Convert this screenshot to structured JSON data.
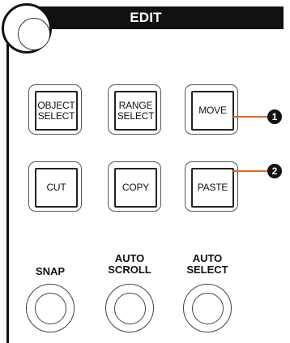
{
  "panel": {
    "title": "EDIT"
  },
  "buttons": {
    "object_select": "OBJECT\nSELECT",
    "range_select": "RANGE\nSELECT",
    "move": "MOVE",
    "cut": "CUT",
    "copy": "COPY",
    "paste": "PASTE"
  },
  "round_buttons": {
    "snap": "SNAP",
    "auto_scroll": "AUTO\nSCROLL",
    "auto_select": "AUTO\nSELECT"
  },
  "callouts": {
    "one": "1",
    "two": "2",
    "line_color": "#e06a1e"
  }
}
